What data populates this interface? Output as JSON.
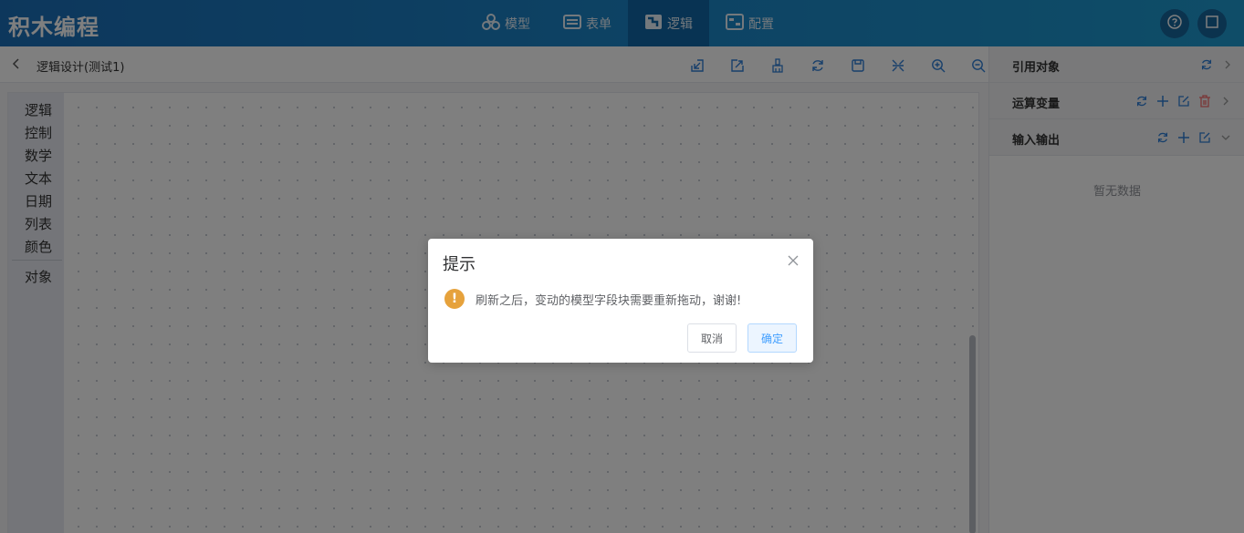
{
  "app": {
    "title": "积木编程"
  },
  "nav": {
    "items": [
      {
        "label": "模型",
        "icon": "model-icon"
      },
      {
        "label": "表单",
        "icon": "form-icon"
      },
      {
        "label": "逻辑",
        "icon": "logic-icon",
        "active": true
      },
      {
        "label": "配置",
        "icon": "config-icon"
      }
    ]
  },
  "header_actions": {
    "help_icon": "help-icon",
    "window_icon": "window-icon"
  },
  "toolbar": {
    "breadcrumb": "逻辑设计(测试1)",
    "tools": [
      "import-icon",
      "export-icon",
      "clear-icon",
      "refresh-icon",
      "save-icon",
      "collapse-icon",
      "zoom-in-icon",
      "zoom-out-icon"
    ]
  },
  "categories": [
    "逻辑",
    "控制",
    "数学",
    "文本",
    "日期",
    "列表",
    "颜色",
    "对象"
  ],
  "right_panel": {
    "sections": [
      {
        "title": "引用对象"
      },
      {
        "title": "运算变量"
      },
      {
        "title": "输入输出"
      }
    ],
    "empty_text": "暂无数据"
  },
  "dialog": {
    "title": "提示",
    "message": "刷新之后，变动的模型字段块需要重新拖动，谢谢!",
    "warn_symbol": "!",
    "cancel_label": "取消",
    "ok_label": "确定"
  },
  "colors": {
    "header": "#1b87c9",
    "accent": "#409eff",
    "warning": "#e6a23c",
    "danger": "#f56c6c"
  }
}
